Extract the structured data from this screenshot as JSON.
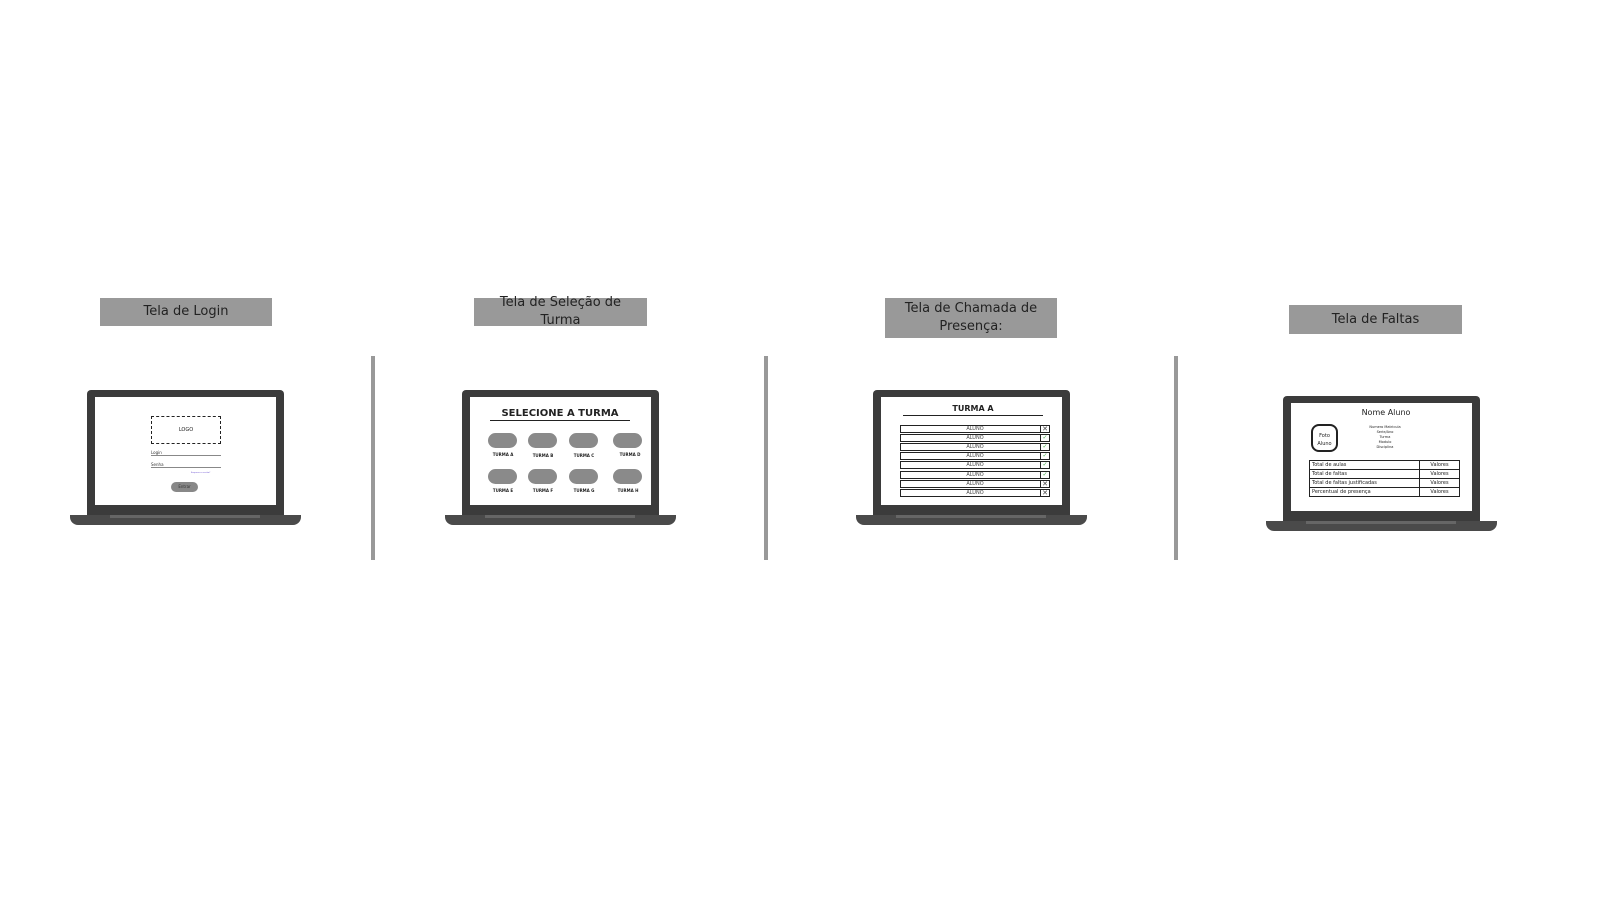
{
  "panels": [
    {
      "title": "Tela de Login",
      "screen": {
        "logo": "LOGO",
        "login_label": "Login",
        "password_label": "Senha",
        "forgot_link": "Esqueceu a senha?",
        "submit": "Entrar"
      }
    },
    {
      "title": "Tela de Seleção de Turma",
      "screen": {
        "heading": "SELECIONE A TURMA",
        "classes": [
          "TURMA A",
          "TURMA B",
          "TURMA C",
          "TURMA D",
          "TURMA E",
          "TURMA F",
          "TURMA G",
          "TURMA H"
        ]
      }
    },
    {
      "title": "Tela de Chamada de Presença:",
      "screen": {
        "heading": "TURMA A",
        "students": [
          {
            "name": "ALUNO",
            "present": false
          },
          {
            "name": "ALUNO",
            "present": true
          },
          {
            "name": "ALUNO",
            "present": true
          },
          {
            "name": "ALUNO",
            "present": true
          },
          {
            "name": "ALUNO",
            "present": true
          },
          {
            "name": "ALUNO",
            "present": true
          },
          {
            "name": "ALUNO",
            "present": false
          },
          {
            "name": "ALUNO",
            "present": false
          }
        ]
      }
    },
    {
      "title": "Tela de Faltas",
      "screen": {
        "name": "Nome Aluno",
        "photo": "Foto Aluno",
        "info": [
          "Numero Matricula",
          "Serie/Ano",
          "Turma",
          "Modulo",
          "Disciplina"
        ],
        "table": [
          {
            "label": "Total de aulas",
            "value": "Valores"
          },
          {
            "label": "Total de faltas",
            "value": "Valores"
          },
          {
            "label": "Total de faltas justificadas",
            "value": "Valores"
          },
          {
            "label": "Percentual de presença",
            "value": "Valores"
          }
        ]
      }
    }
  ],
  "colors": {
    "label_bg": "#999999",
    "check": "#4caf50"
  }
}
